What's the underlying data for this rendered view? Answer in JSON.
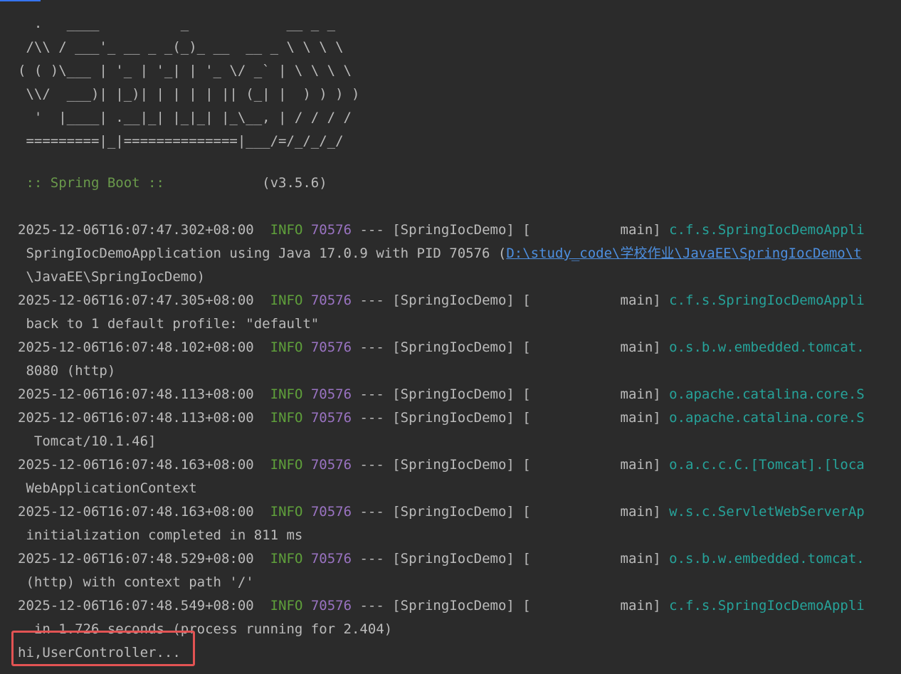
{
  "banner": [
    "  .   ____          _            __ _ _",
    " /\\\\ / ___'_ __ _ _(_)_ __  __ _ \\ \\ \\ \\",
    "( ( )\\___ | '_ | '_| | '_ \\/ _` | \\ \\ \\ \\",
    " \\\\/  ___)| |_)| | | | | || (_| |  ) ) ) )",
    "  '  |____| .__|_| |_|_| |_\\__, | / / / /",
    " =========|_|==============|___/=/_/_/_/"
  ],
  "boot_label": " :: Spring Boot :: ",
  "boot_version": "           (v3.5.6)",
  "logs": [
    {
      "ts": "2025-12-06T16:07:47.302+08:00",
      "level": "INFO",
      "pid": "70576",
      "mid": " --- [SpringIocDemo] [           main] ",
      "logger": "c.f.s.SpringIocDemoAppli"
    },
    {
      "ts": "2025-12-06T16:07:47.305+08:00",
      "level": "INFO",
      "pid": "70576",
      "mid": " --- [SpringIocDemo] [           main] ",
      "logger": "c.f.s.SpringIocDemoAppli"
    },
    {
      "ts": "2025-12-06T16:07:48.102+08:00",
      "level": "INFO",
      "pid": "70576",
      "mid": " --- [SpringIocDemo] [           main] ",
      "logger": "o.s.b.w.embedded.tomcat."
    },
    {
      "ts": "2025-12-06T16:07:48.113+08:00",
      "level": "INFO",
      "pid": "70576",
      "mid": " --- [SpringIocDemo] [           main] ",
      "logger": "o.apache.catalina.core.S"
    },
    {
      "ts": "2025-12-06T16:07:48.113+08:00",
      "level": "INFO",
      "pid": "70576",
      "mid": " --- [SpringIocDemo] [           main] ",
      "logger": "o.apache.catalina.core.S"
    },
    {
      "ts": "2025-12-06T16:07:48.163+08:00",
      "level": "INFO",
      "pid": "70576",
      "mid": " --- [SpringIocDemo] [           main] ",
      "logger": "o.a.c.c.C.[Tomcat].[loca"
    },
    {
      "ts": "2025-12-06T16:07:48.163+08:00",
      "level": "INFO",
      "pid": "70576",
      "mid": " --- [SpringIocDemo] [           main] ",
      "logger": "w.s.c.ServletWebServerAp"
    },
    {
      "ts": "2025-12-06T16:07:48.529+08:00",
      "level": "INFO",
      "pid": "70576",
      "mid": " --- [SpringIocDemo] [           main] ",
      "logger": "o.s.b.w.embedded.tomcat."
    },
    {
      "ts": "2025-12-06T16:07:48.549+08:00",
      "level": "INFO",
      "pid": "70576",
      "mid": " --- [SpringIocDemo] [           main] ",
      "logger": "c.f.s.SpringIocDemoAppli"
    }
  ],
  "wrapped": {
    "w1_pre": " SpringIocDemoApplication using Java 17.0.9 with PID 70576 (",
    "w1_link_a": "D:\\study_code\\",
    "w1_link_cjk": "学校作业",
    "w1_link_b": "\\JavaEE\\SpringIocDemo\\t",
    "w2": " \\JavaEE\\SpringIocDemo)",
    "w3": " back to 1 default profile: \"default\"",
    "w4": " 8080 (http)",
    "w5": "  Tomcat/10.1.46]",
    "w6": " WebApplicationContext",
    "w7": " initialization completed in 811 ms",
    "w8": " (http) with context path '/'",
    "w9": "  in 1.726 seconds (process running for 2.404)"
  },
  "output_line": "hi,UserController..."
}
